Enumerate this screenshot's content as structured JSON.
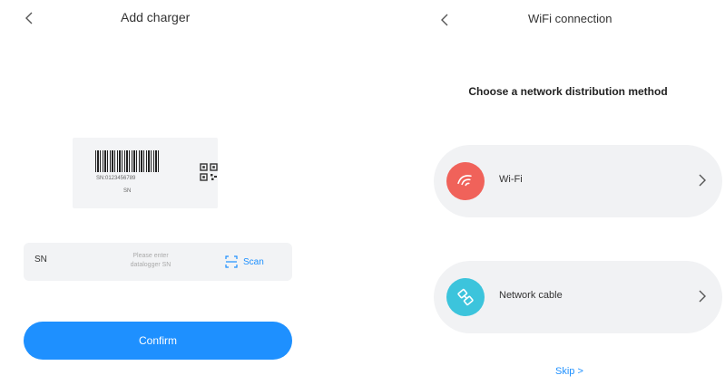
{
  "left_screen": {
    "title": "Add charger",
    "label_card": {
      "serial_text": "SN:0123456789",
      "sn_caption": "SN"
    },
    "sn_field": {
      "label": "SN",
      "placeholder": "Please enter\ndatalogger SN",
      "scan_label": "Scan"
    },
    "confirm_label": "Confirm"
  },
  "right_screen": {
    "title": "WiFi connection",
    "heading": "Choose a network distribution method",
    "options": [
      {
        "label": "Wi-Fi",
        "icon": "wifi-icon",
        "color": "#f0625a"
      },
      {
        "label": "Network cable",
        "icon": "network-cable-icon",
        "color": "#3cc4dc"
      }
    ],
    "skip_label": "Skip  >"
  },
  "colors": {
    "accent": "#1e90ff",
    "wifi": "#f0625a",
    "cable": "#3cc4dc",
    "field_bg": "#f2f3f5"
  }
}
